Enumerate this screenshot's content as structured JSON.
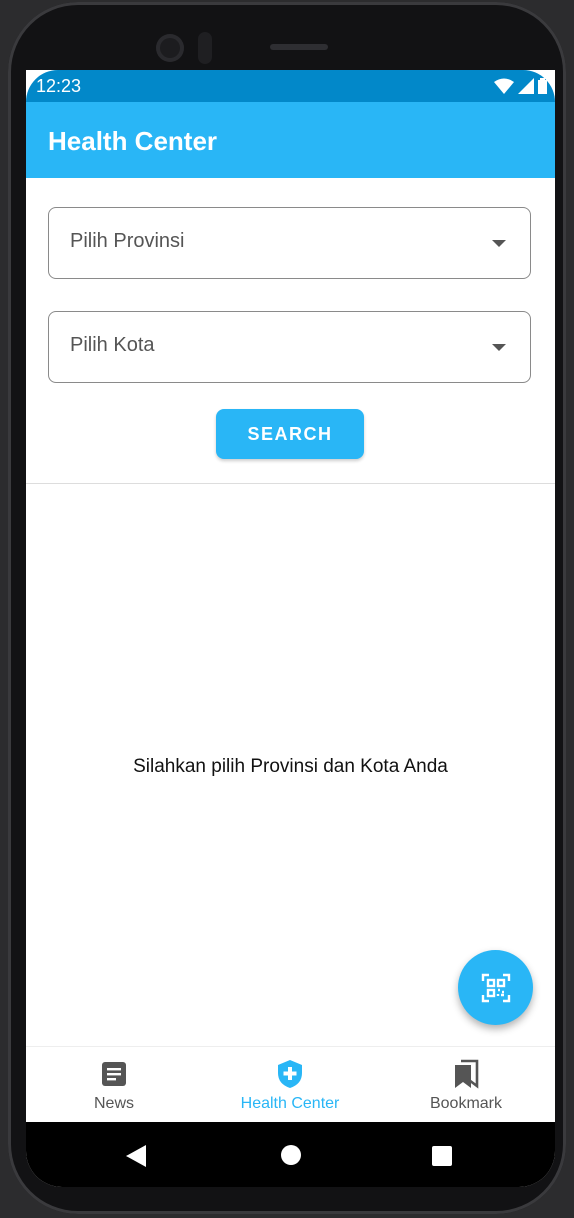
{
  "status": {
    "time": "12:23"
  },
  "appbar": {
    "title": "Health Center"
  },
  "filters": {
    "province_placeholder": "Pilih Provinsi",
    "city_placeholder": "Pilih Kota",
    "search_label": "SEARCH"
  },
  "content": {
    "empty_message": "Silahkan pilih Provinsi dan Kota Anda"
  },
  "fab": {
    "icon": "qr-scan-icon"
  },
  "bottom_nav": {
    "items": [
      {
        "label": "News",
        "icon": "article-icon",
        "active": false
      },
      {
        "label": "Health Center",
        "icon": "shield-plus-icon",
        "active": true
      },
      {
        "label": "Bookmark",
        "icon": "bookmarks-icon",
        "active": false
      }
    ]
  },
  "colors": {
    "primary": "#29b6f6",
    "status_bar": "#0288c9",
    "inactive": "#555555"
  }
}
